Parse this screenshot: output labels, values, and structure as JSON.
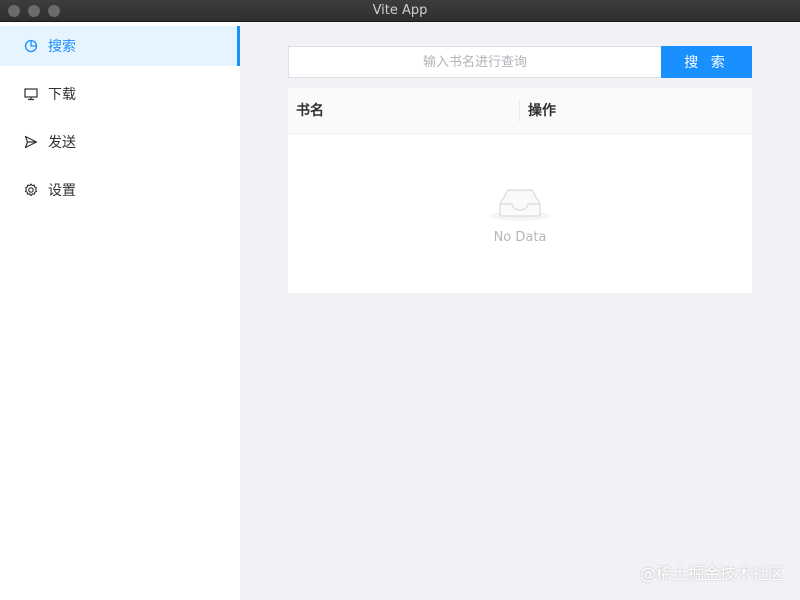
{
  "window": {
    "title": "Vite App"
  },
  "sidebar": {
    "items": [
      {
        "label": "搜索",
        "icon": "pie-chart-icon",
        "active": true
      },
      {
        "label": "下载",
        "icon": "monitor-icon"
      },
      {
        "label": "发送",
        "icon": "send-icon"
      },
      {
        "label": "设置",
        "icon": "gear-icon"
      }
    ]
  },
  "search": {
    "placeholder": "输入书名进行查询",
    "value": "",
    "button_label": "搜 索"
  },
  "table": {
    "columns": [
      "书名",
      "操作"
    ],
    "empty_text": "No Data"
  },
  "watermark": "@稀土掘金技术社区",
  "colors": {
    "accent": "#1890ff",
    "active_bg": "#e6f4ff",
    "page_bg": "#f0f2f5"
  }
}
